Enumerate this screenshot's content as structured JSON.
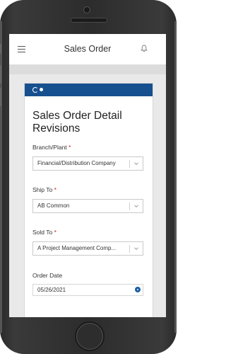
{
  "app": {
    "title": "Sales Order"
  },
  "icons": {
    "menu": "menu-icon",
    "bell": "bell-icon",
    "chevron": "chevron-down-icon",
    "calendar": "calendar-icon"
  },
  "colors": {
    "header_accent": "#16508f",
    "required": "#c0282d",
    "date_picker": "#1d5fa6"
  },
  "form": {
    "title": "Sales Order Detail Revisions",
    "branch_plant": {
      "label": "Branch/Plant",
      "required_mark": "*",
      "value": "Financial/Distribution Company"
    },
    "ship_to": {
      "label": "Ship To",
      "required_mark": "*",
      "value": "AB Common"
    },
    "sold_to": {
      "label": "Sold To",
      "required_mark": "*",
      "value": "A Project Management Comp..."
    },
    "order_date": {
      "label": "Order Date",
      "value": "05/26/2021"
    }
  }
}
